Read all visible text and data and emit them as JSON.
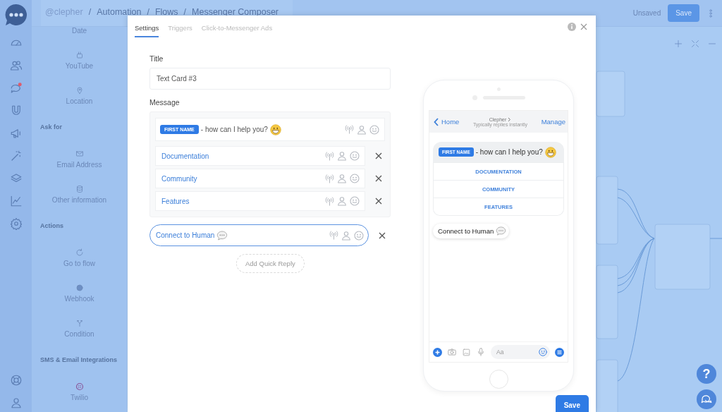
{
  "app": {
    "breadcrumb": [
      "@clepher",
      "/",
      "Automation",
      "/",
      "Flows",
      "/",
      "Messenger Composer"
    ],
    "status": "Unsaved",
    "save_button": "Save",
    "help_button": "?"
  },
  "palette": [
    {
      "kind": "item",
      "label": "Date"
    },
    {
      "kind": "item",
      "label": "YouTube"
    },
    {
      "kind": "item",
      "label": "Location"
    },
    {
      "kind": "header",
      "label": "Ask for"
    },
    {
      "kind": "item",
      "label": "Email Address"
    },
    {
      "kind": "item",
      "label": "Other information"
    },
    {
      "kind": "header",
      "label": "Actions"
    },
    {
      "kind": "item",
      "label": "Go to flow"
    },
    {
      "kind": "item",
      "label": "Webhook"
    },
    {
      "kind": "item",
      "label": "Condition"
    },
    {
      "kind": "header",
      "label": "SMS & Email Integrations"
    },
    {
      "kind": "item",
      "label": "Twilio"
    }
  ],
  "modal": {
    "tabs": [
      {
        "label": "Settings",
        "selected": true
      },
      {
        "label": "Triggers",
        "selected": false
      },
      {
        "label": "Click-to-Messenger Ads",
        "selected": false
      }
    ],
    "title_label": "Title",
    "title_value": "Text Card #3",
    "message_label": "Message",
    "message": {
      "tag": "FIRST NAME",
      "text": "- how can I help you?"
    },
    "buttons": [
      {
        "label": "Documentation"
      },
      {
        "label": "Community"
      },
      {
        "label": "Features"
      }
    ],
    "quick_replies": [
      {
        "label": "Connect to Human"
      }
    ],
    "add_quick_reply": "Add Quick Reply",
    "save_button": "Save"
  },
  "preview": {
    "back": "Home",
    "page_name": "Clepher",
    "subtitle": "Typically replies instantly",
    "manage": "Manage",
    "message": {
      "tag": "FIRST NAME",
      "text": "- how can I help you?"
    },
    "buttons": [
      "DOCUMENTATION",
      "COMMUNITY",
      "FEATURES"
    ],
    "quick_replies": [
      "Connect to Human"
    ],
    "composer_placeholder": "Aa"
  }
}
